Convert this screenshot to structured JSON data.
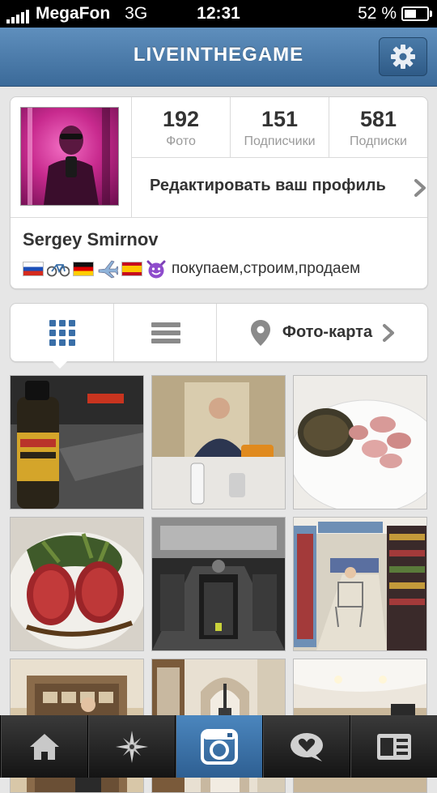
{
  "status_bar": {
    "carrier": "MegaFon",
    "network": "3G",
    "time": "12:31",
    "battery_text": "52 %",
    "battery_level": 0.52
  },
  "nav": {
    "title": "LIVEINTHEGAME",
    "settings_icon": "gear-icon"
  },
  "profile": {
    "stats": [
      {
        "value": "192",
        "label": "Фото"
      },
      {
        "value": "151",
        "label": "Подписчики"
      },
      {
        "value": "581",
        "label": "Подписки"
      }
    ],
    "edit_label": "Редактировать ваш профиль",
    "full_name": "Sergey Smirnov",
    "bio_emoji": [
      "russia-flag",
      "bicycle",
      "germany-flag",
      "airplane",
      "spain-flag",
      "smiling-devil"
    ],
    "bio_text": "покупаем,строим,продаем"
  },
  "view_tabs": {
    "grid_icon": "grid-icon",
    "list_icon": "list-icon",
    "map_icon": "map-pin-icon",
    "map_label": "Фото-карта",
    "active": "grid"
  },
  "photos": [
    {
      "subject": "sports drink bottle",
      "colors": [
        "#2a2418",
        "#d4a52a",
        "#5d5240"
      ]
    },
    {
      "subject": "mirror selfie in bathroom",
      "colors": [
        "#cfc2a5",
        "#2c3650",
        "#8a7a60"
      ]
    },
    {
      "subject": "seafood plate with rice",
      "colors": [
        "#f2f0ec",
        "#d89a98",
        "#3f3a2a"
      ]
    },
    {
      "subject": "steak with salad",
      "colors": [
        "#e8e4dd",
        "#a0262a",
        "#3f5a2a"
      ]
    },
    {
      "subject": "gym treadmills",
      "colors": [
        "#3a3a3a",
        "#9a9a9a",
        "#1c1c1c"
      ]
    },
    {
      "subject": "supermarket aisle",
      "colors": [
        "#d8d2c4",
        "#6e8fb5",
        "#a33a3a"
      ]
    },
    {
      "subject": "ornate corridor",
      "colors": [
        "#8a6b4a",
        "#d8c7a8",
        "#3a2a1a"
      ]
    },
    {
      "subject": "arched hallway",
      "colors": [
        "#e8e0d2",
        "#7a5a3a",
        "#c8b8a0"
      ]
    },
    {
      "subject": "restaurant interior",
      "colors": [
        "#ece6dc",
        "#c9b79a",
        "#6a5a4a"
      ]
    }
  ],
  "tab_bar": [
    {
      "name": "home",
      "icon": "home-icon",
      "active": false
    },
    {
      "name": "explore",
      "icon": "star-compass-icon",
      "active": false
    },
    {
      "name": "camera",
      "icon": "camera-icon",
      "active": true
    },
    {
      "name": "news",
      "icon": "speech-heart-icon",
      "active": false
    },
    {
      "name": "profile",
      "icon": "profile-card-icon",
      "active": false
    }
  ],
  "colors": {
    "nav_blue": "#3b6a99",
    "active_tab_blue": "#2e5f92",
    "grid_icon_blue": "#3a6fa8"
  }
}
